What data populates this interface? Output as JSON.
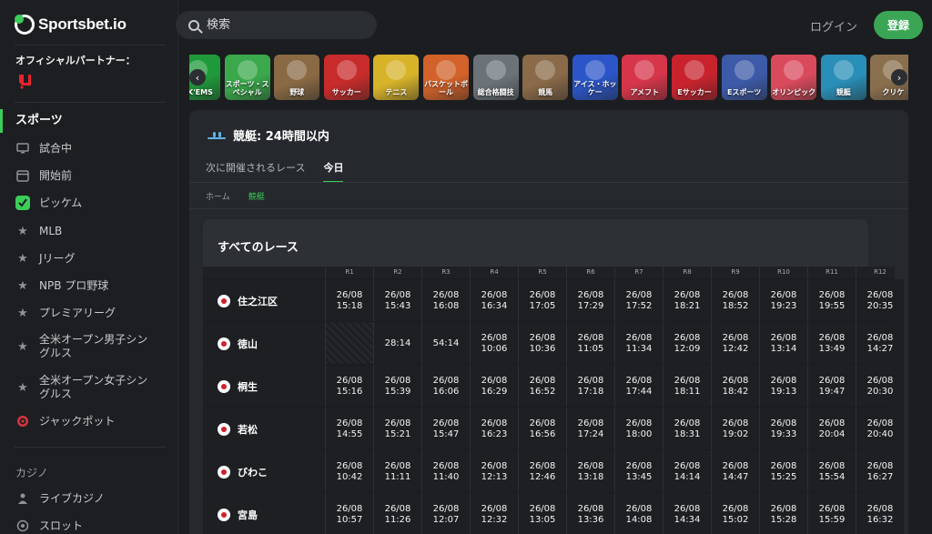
{
  "brand": {
    "name": "Sportsbet.io"
  },
  "sidebar": {
    "partner_label": "オフィシャルパートナー：",
    "sports_heading": "スポーツ",
    "items": [
      {
        "label": "試合中",
        "icon": "monitor-icon"
      },
      {
        "label": "開始前",
        "icon": "calendar-icon"
      },
      {
        "label": "ピッケム",
        "icon": "pickem-icon"
      },
      {
        "label": "MLB",
        "icon": "star-icon"
      },
      {
        "label": "Jリーグ",
        "icon": "star-icon"
      },
      {
        "label": "NPB プロ野球",
        "icon": "star-icon"
      },
      {
        "label": "プレミアリーグ",
        "icon": "star-icon"
      },
      {
        "label": "全米オープン男子シングルス",
        "icon": "star-icon"
      },
      {
        "label": "全米オープン女子シングルス",
        "icon": "star-icon"
      },
      {
        "label": "ジャックポット",
        "icon": "target-icon"
      }
    ],
    "casino_label": "カジノ",
    "casino_items": [
      {
        "label": "ライブカジノ",
        "icon": "dealer-icon"
      },
      {
        "label": "スロット",
        "icon": "slot-icon"
      }
    ]
  },
  "header": {
    "search_placeholder": "検索",
    "login_label": "ログイン",
    "register_label": "登録"
  },
  "sport_tiles": [
    {
      "label": "CK'EMS",
      "color": "#1f9a3a"
    },
    {
      "label": "スポーツ・スペシャル",
      "color": "#3aa84b"
    },
    {
      "label": "野球",
      "color": "#8a6a44"
    },
    {
      "label": "サッカー",
      "color": "#c82b2b"
    },
    {
      "label": "テニス",
      "color": "#d7b32a"
    },
    {
      "label": "バスケットボール",
      "color": "#d2622a"
    },
    {
      "label": "総合格闘技",
      "color": "#6c7378"
    },
    {
      "label": "競馬",
      "color": "#8a6a48"
    },
    {
      "label": "アイス・ホッケー",
      "color": "#2b55c8"
    },
    {
      "label": "アメフト",
      "color": "#d6354a"
    },
    {
      "label": "Eサッカー",
      "color": "#c8232d"
    },
    {
      "label": "Eスポーツ",
      "color": "#3c5aa8"
    },
    {
      "label": "オリンピック",
      "color": "#d94a5c"
    },
    {
      "label": "競艇",
      "color": "#2a8fb8"
    },
    {
      "label": "クリケ",
      "color": "#8a6f4e"
    }
  ],
  "page": {
    "title": "競艇: 24時間以内",
    "tabs": [
      {
        "label": "次に開催されるレース",
        "active": false
      },
      {
        "label": "今日",
        "active": true
      }
    ],
    "breadcrumb": [
      "ホーム",
      "競艇"
    ],
    "section_title": "すべてのレース"
  },
  "races": {
    "columns": [
      "R1",
      "R2",
      "R3",
      "R4",
      "R5",
      "R6",
      "R7",
      "R8",
      "R9",
      "R10",
      "R11",
      "R12"
    ],
    "rows": [
      {
        "venue": "住之江区",
        "times": [
          [
            "26/08",
            "15:18"
          ],
          [
            "26/08",
            "15:43"
          ],
          [
            "26/08",
            "16:08"
          ],
          [
            "26/08",
            "16:34"
          ],
          [
            "26/08",
            "17:05"
          ],
          [
            "26/08",
            "17:29"
          ],
          [
            "26/08",
            "17:52"
          ],
          [
            "26/08",
            "18:21"
          ],
          [
            "26/08",
            "18:52"
          ],
          [
            "26/08",
            "19:23"
          ],
          [
            "26/08",
            "19:55"
          ],
          [
            "26/08",
            "20:35"
          ]
        ]
      },
      {
        "venue": "徳山",
        "times": [
          null,
          [
            "",
            "28:14"
          ],
          [
            "",
            "54:14"
          ],
          [
            "26/08",
            "10:06"
          ],
          [
            "26/08",
            "10:36"
          ],
          [
            "26/08",
            "11:05"
          ],
          [
            "26/08",
            "11:34"
          ],
          [
            "26/08",
            "12:09"
          ],
          [
            "26/08",
            "12:42"
          ],
          [
            "26/08",
            "13:14"
          ],
          [
            "26/08",
            "13:49"
          ],
          [
            "26/08",
            "14:27"
          ]
        ]
      },
      {
        "venue": "桐生",
        "times": [
          [
            "26/08",
            "15:16"
          ],
          [
            "26/08",
            "15:39"
          ],
          [
            "26/08",
            "16:06"
          ],
          [
            "26/08",
            "16:29"
          ],
          [
            "26/08",
            "16:52"
          ],
          [
            "26/08",
            "17:18"
          ],
          [
            "26/08",
            "17:44"
          ],
          [
            "26/08",
            "18:11"
          ],
          [
            "26/08",
            "18:42"
          ],
          [
            "26/08",
            "19:13"
          ],
          [
            "26/08",
            "19:47"
          ],
          [
            "26/08",
            "20:30"
          ]
        ]
      },
      {
        "venue": "若松",
        "times": [
          [
            "26/08",
            "14:55"
          ],
          [
            "26/08",
            "15:21"
          ],
          [
            "26/08",
            "15:47"
          ],
          [
            "26/08",
            "16:23"
          ],
          [
            "26/08",
            "16:56"
          ],
          [
            "26/08",
            "17:24"
          ],
          [
            "26/08",
            "18:00"
          ],
          [
            "26/08",
            "18:31"
          ],
          [
            "26/08",
            "19:02"
          ],
          [
            "26/08",
            "19:33"
          ],
          [
            "26/08",
            "20:04"
          ],
          [
            "26/08",
            "20:40"
          ]
        ]
      },
      {
        "venue": "びわこ",
        "times": [
          [
            "26/08",
            "10:42"
          ],
          [
            "26/08",
            "11:11"
          ],
          [
            "26/08",
            "11:40"
          ],
          [
            "26/08",
            "12:13"
          ],
          [
            "26/08",
            "12:46"
          ],
          [
            "26/08",
            "13:18"
          ],
          [
            "26/08",
            "13:45"
          ],
          [
            "26/08",
            "14:14"
          ],
          [
            "26/08",
            "14:47"
          ],
          [
            "26/08",
            "15:25"
          ],
          [
            "26/08",
            "15:54"
          ],
          [
            "26/08",
            "16:27"
          ]
        ]
      },
      {
        "venue": "宮島",
        "times": [
          [
            "26/08",
            "10:57"
          ],
          [
            "26/08",
            "11:26"
          ],
          [
            "26/08",
            "12:07"
          ],
          [
            "26/08",
            "12:32"
          ],
          [
            "26/08",
            "13:05"
          ],
          [
            "26/08",
            "13:36"
          ],
          [
            "26/08",
            "14:08"
          ],
          [
            "26/08",
            "14:34"
          ],
          [
            "26/08",
            "15:02"
          ],
          [
            "26/08",
            "15:28"
          ],
          [
            "26/08",
            "15:59"
          ],
          [
            "26/08",
            "16:32"
          ]
        ]
      }
    ]
  }
}
